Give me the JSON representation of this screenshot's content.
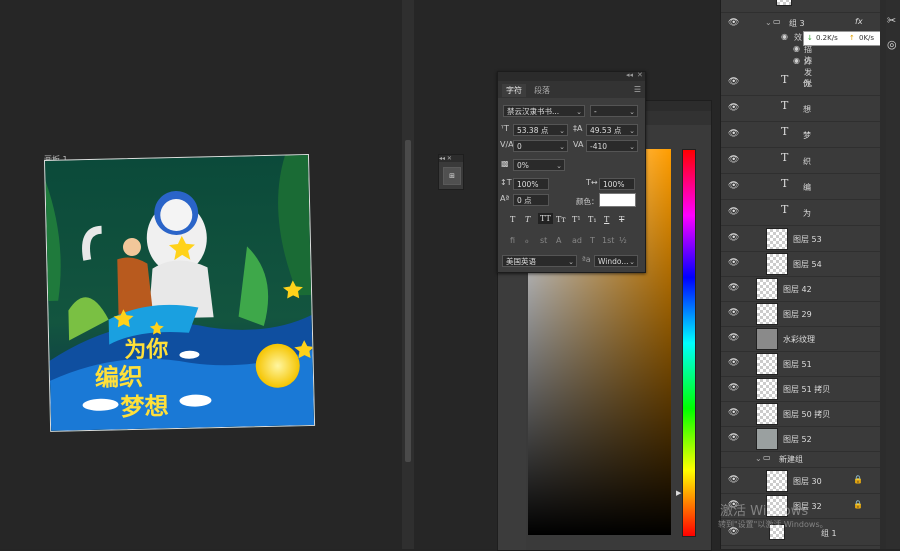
{
  "artboard": {
    "label": "画板 1"
  },
  "artwork": {
    "title_lines": [
      "为你",
      "编织",
      "梦想"
    ]
  },
  "mini_panel": {
    "header": "◂◂  ✕",
    "button": "⊞"
  },
  "character_panel": {
    "tabs": [
      "字符",
      "段落"
    ],
    "font_family": "禁云汉隶书书...",
    "font_style": "-",
    "font_size": "53.38 点",
    "leading": "49.53 点",
    "kerning": "0",
    "tracking": "-410",
    "scale_ratio": "0%",
    "vertical_scale": "100%",
    "horizontal_scale": "100%",
    "baseline_shift": "0 点",
    "color_label": "颜色：",
    "color_value": "#ffffff",
    "type_buttons": [
      "T",
      "T",
      "TT",
      "Tт",
      "T¹",
      "T₁",
      "T",
      "T"
    ],
    "opentype_buttons": [
      "fi",
      "ℴ",
      "st",
      "A",
      "ad",
      "T",
      "1st",
      "½"
    ],
    "language": "美国英语",
    "antialias": "Windo..."
  },
  "network_badge": {
    "down": "0.2K/s",
    "up": "0K/s"
  },
  "layers": {
    "group3": {
      "name": "组 3",
      "fx": "fx"
    },
    "effects": {
      "label": "效",
      "items": [
        "描边",
        "外发光"
      ]
    },
    "text_layers": [
      "你",
      "想",
      "梦",
      "织",
      "编",
      "为"
    ],
    "image_layers": [
      {
        "name": "图层 53"
      },
      {
        "name": "图层 54"
      },
      {
        "name": "图层 42"
      },
      {
        "name": "图层 29"
      },
      {
        "name": "水彩纹理"
      },
      {
        "name": "图层 51"
      },
      {
        "name": "图层 51 拷贝"
      },
      {
        "name": "图层 50 拷贝"
      },
      {
        "name": "图层 52"
      }
    ],
    "new_group": "新建组",
    "locked_layers": [
      "图层 30",
      "图层 32"
    ],
    "group1": "组 1"
  },
  "watermark": {
    "line1": "激活 Windows",
    "line2": "转到\"设置\"以激活 Windows。"
  }
}
